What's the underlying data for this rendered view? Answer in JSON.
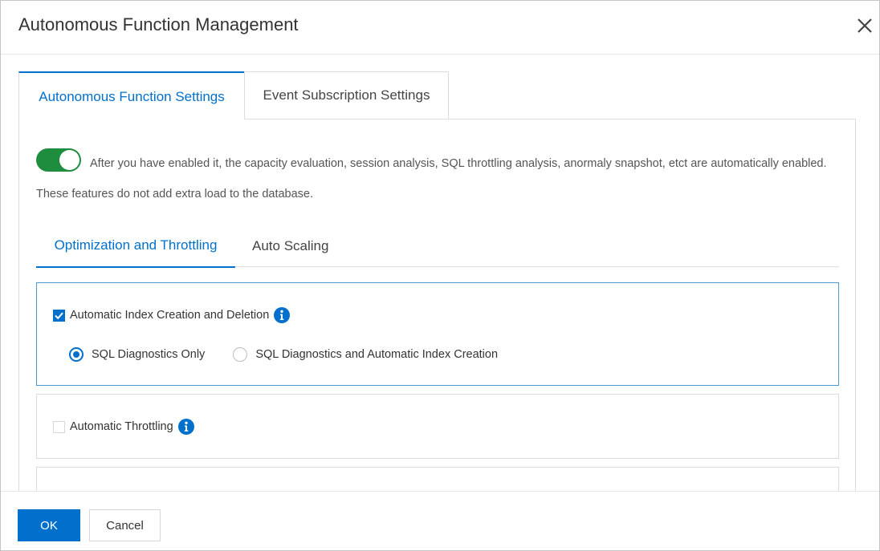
{
  "dialog": {
    "title": "Autonomous Function Management",
    "close_icon": "close-icon"
  },
  "tabs": [
    {
      "label": "Autonomous Function Settings",
      "active": true
    },
    {
      "label": "Event Subscription Settings",
      "active": false
    }
  ],
  "autonomous": {
    "toggle_enabled": true,
    "description": "After you have enabled it, the capacity evaluation, session analysis, SQL throttling analysis, anormaly snapshot, etct are automatically enabled. These features do not add extra load to the database."
  },
  "subtabs": [
    {
      "label": "Optimization and Throttling",
      "active": true
    },
    {
      "label": "Auto Scaling",
      "active": false
    }
  ],
  "features": [
    {
      "label": "Automatic Index Creation and Deletion",
      "checked": true,
      "info_icon": "info-icon",
      "options": [
        {
          "label": "SQL Diagnostics Only",
          "selected": true
        },
        {
          "label": "SQL Diagnostics and Automatic Index Creation",
          "selected": false
        }
      ]
    },
    {
      "label": "Automatic Throttling",
      "checked": false,
      "info_icon": "info-icon"
    }
  ],
  "footer": {
    "ok_label": "OK",
    "cancel_label": "Cancel"
  },
  "colors": {
    "accent": "#0070cc",
    "toggle_on": "#1e8e3e",
    "active_card_border": "#4a9ad4"
  }
}
